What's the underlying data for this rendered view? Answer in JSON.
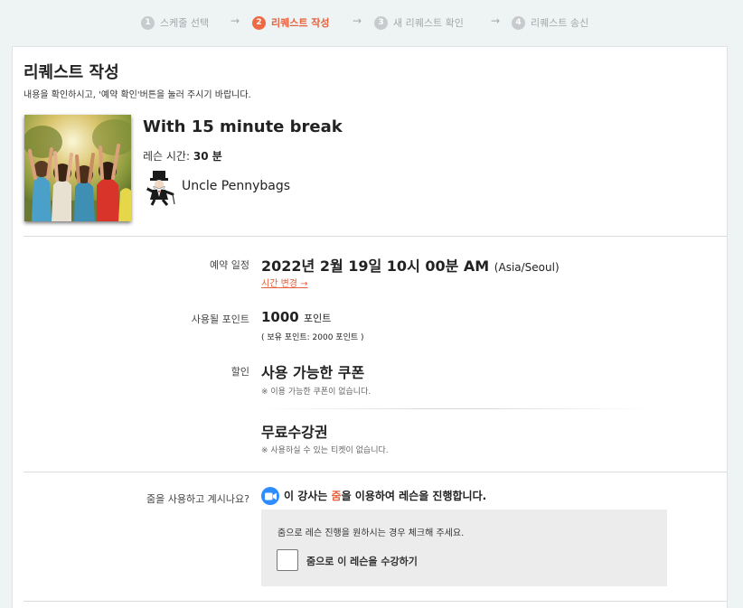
{
  "steps": [
    {
      "num": "1",
      "label": "스케줄 선택"
    },
    {
      "num": "2",
      "label": "리퀘스트 작성"
    },
    {
      "num": "3",
      "label": "새 리퀘스트 확인"
    },
    {
      "num": "4",
      "label": "리퀘스트 송신"
    }
  ],
  "active_step": 2,
  "arrow": "→",
  "page": {
    "title": "리퀘스트 작성",
    "subtitle": "내용을 확인하시고, '예약 확인'버튼을 눌러 주시기 바랍니다."
  },
  "lesson": {
    "title": "With 15 minute break",
    "time_label": "레슨 시간:",
    "time_value": "30 분",
    "tutor_name": "Uncle Pennybags"
  },
  "booking": {
    "date_label": "예약 일정",
    "date_value": "2022년 2월 19일 10시 00분 AM",
    "timezone": "(Asia/Seoul)",
    "change_link": "시간 변경 →",
    "points_label": "사용될 포인트",
    "points_value": "1000",
    "points_unit": "포인트",
    "points_note": "( 보유 포인트: 2000 포인트 )",
    "discount_label": "할인",
    "coupon_title": "사용 가능한 쿠폰",
    "coupon_note": "※ 이용 가능한 쿠폰이 없습니다.",
    "ticket_title": "무료수강권",
    "ticket_note": "※ 사용하실 수 있는 티켓이 없습니다."
  },
  "zoom": {
    "question": "줌을 사용하고 계시나요?",
    "text_before": "이 강사는 ",
    "text_highlight": "줌",
    "text_after": "을 이용하여 레슨을 진행합니다.",
    "desc": "줌으로 레슨 진행을 원하시는 경우 체크해 주세요.",
    "checkbox_label": "줌으로 이 레슨을 수강하기",
    "checked": false
  },
  "colors": {
    "accent": "#e8603c",
    "zoom_blue": "#2d8cff",
    "background": "#eef3f3"
  }
}
